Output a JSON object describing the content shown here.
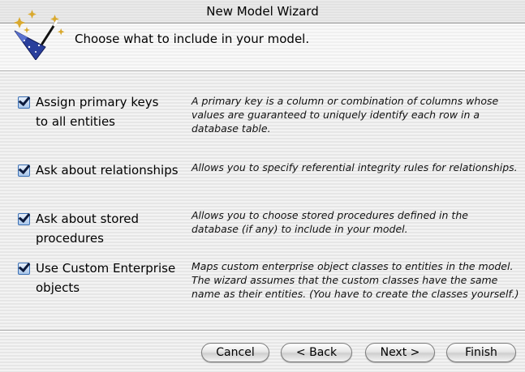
{
  "window": {
    "title": "New Model Wizard"
  },
  "header": {
    "text": "Choose what to include in your model.",
    "icon": "wizard-hat-wand-icon"
  },
  "options": [
    {
      "label_lines": [
        "Assign primary keys",
        "to all entities"
      ],
      "checked": true,
      "description": "A primary key is a column or combination of columns whose\nvalues are guaranteed to uniquely identify each row in a\ndatabase table."
    },
    {
      "label_lines": [
        "Ask about relationships"
      ],
      "checked": true,
      "description": "Allows you to specify referential integrity rules for relationships."
    },
    {
      "label_lines": [
        "Ask about stored",
        "procedures"
      ],
      "checked": true,
      "description": "Allows you to choose stored procedures defined in the\ndatabase (if any) to include in your model."
    },
    {
      "label_lines": [
        "Use Custom Enterprise",
        "objects"
      ],
      "checked": true,
      "description": "Maps custom enterprise object classes to entities in the model.\nThe wizard assumes that the custom classes have the same\nname as their entities. (You have to create the classes yourself.)"
    }
  ],
  "buttons": {
    "cancel": "Cancel",
    "back": "< Back",
    "next": "Next >",
    "finish": "Finish"
  }
}
